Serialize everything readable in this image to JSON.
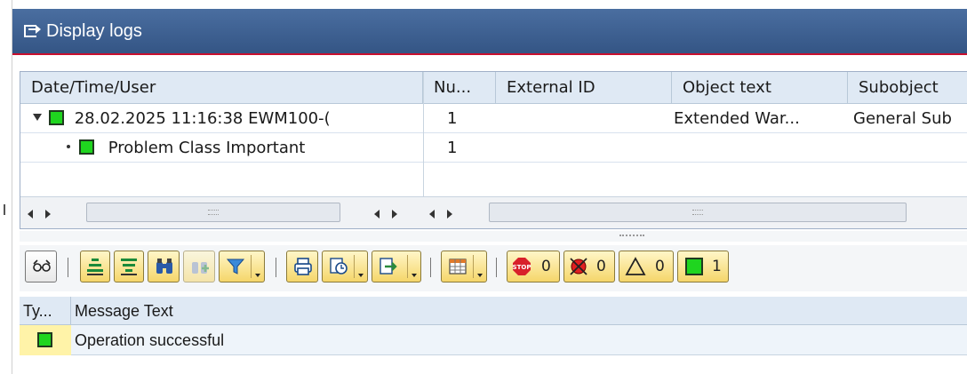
{
  "window": {
    "title": "Display logs"
  },
  "log_table": {
    "columns": [
      {
        "label": "Date/Time/User"
      },
      {
        "label": "Nu..."
      },
      {
        "label": "External ID"
      },
      {
        "label": "Object text"
      },
      {
        "label": "Subobject"
      }
    ],
    "rows": [
      {
        "date_time_user": "28.02.2025  11:16:38  EWM100-(",
        "number": "1",
        "external_id": "",
        "object_text": "Extended War...",
        "subobject": "General Sub",
        "level": 0
      },
      {
        "date_time_user": "Problem Class Important",
        "number": "1",
        "external_id": "",
        "object_text": "",
        "subobject": "",
        "level": 1
      }
    ]
  },
  "toolbar": {
    "counts": {
      "error_stop": "0",
      "error": "0",
      "warning": "0",
      "success": "1"
    }
  },
  "messages": {
    "columns": [
      {
        "label": "Ty..."
      },
      {
        "label": "Message Text"
      }
    ],
    "rows": [
      {
        "text": "Operation successful",
        "status": "success"
      }
    ]
  },
  "colors": {
    "titlebar": "#3d5f92",
    "header": "#dfe9f4",
    "success": "#1fd51f",
    "button": "#f5d66a"
  }
}
